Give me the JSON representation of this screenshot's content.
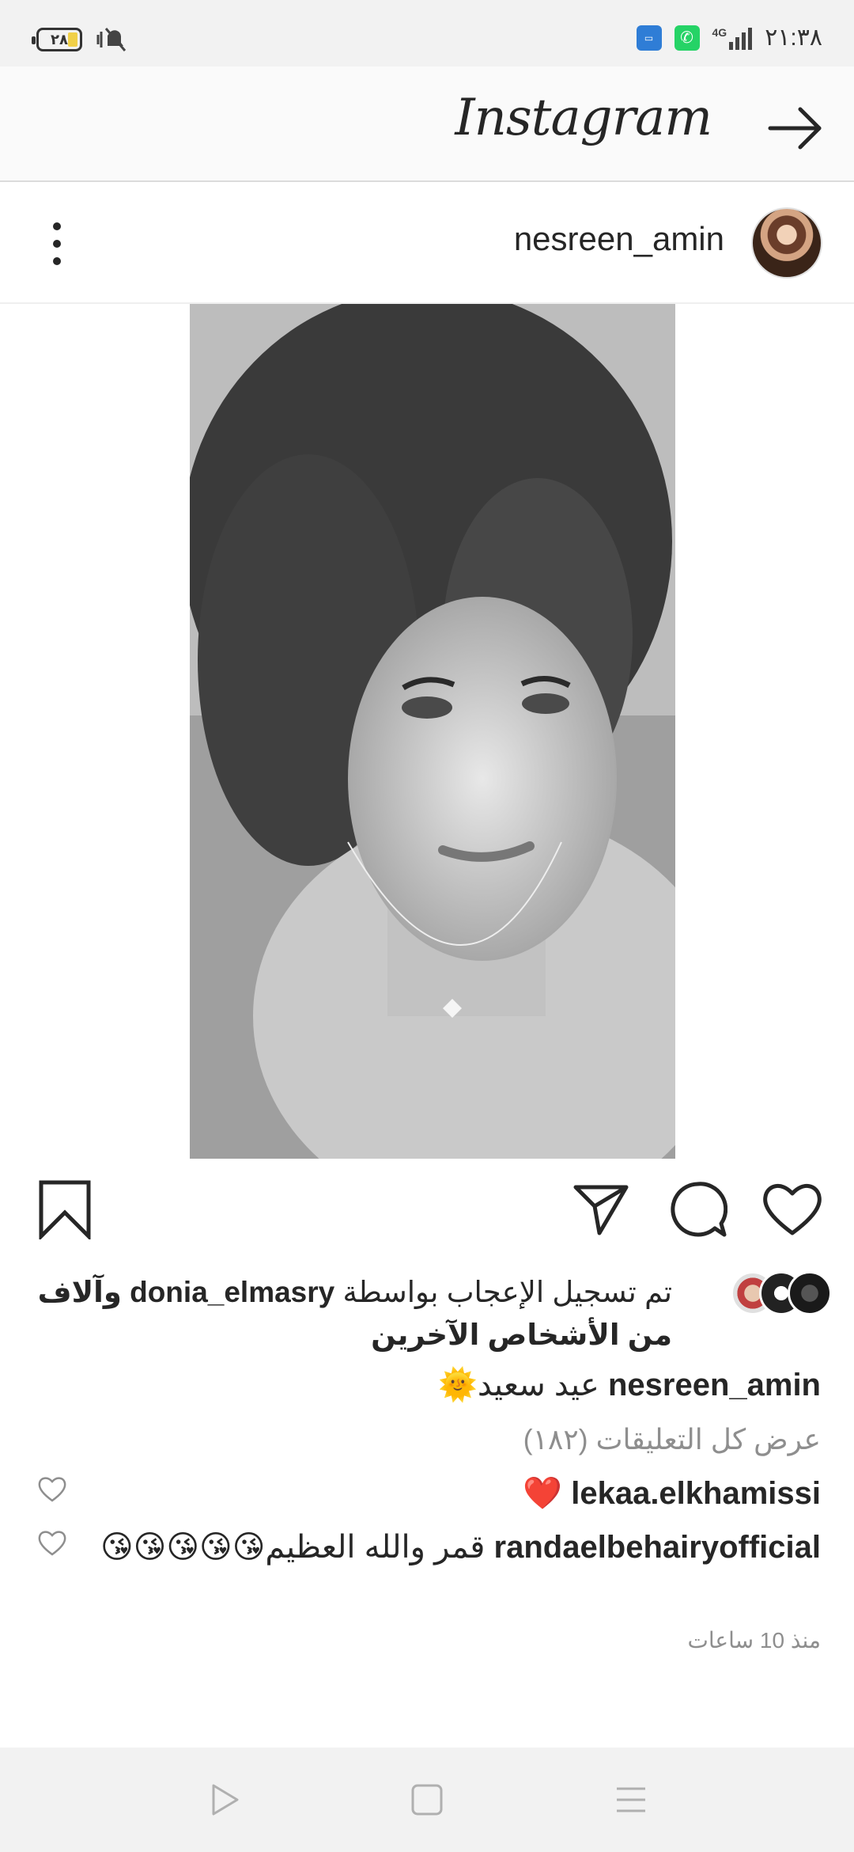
{
  "status_bar": {
    "time": "٢١:٣٨",
    "battery": "٢٨",
    "network": "4G",
    "apps": [
      "whatsapp",
      "app-blue"
    ],
    "icons": [
      "battery-icon",
      "silent-icon",
      "whatsapp-icon",
      "app-icon",
      "signal-icon"
    ]
  },
  "header": {
    "logo": "Instagram",
    "forward_icon": "arrow-right-icon"
  },
  "post": {
    "username": "nesreen_amin",
    "more_icon": "more-vertical-icon",
    "photo_alt": "black and white photo",
    "actions": [
      "heart-icon",
      "comment-icon",
      "share-icon",
      "bookmark-icon"
    ],
    "likes": {
      "prefix": "تم تسجيل الإعجاب بواسطة",
      "user": "donia_elmasry",
      "suffix": "وآلاف",
      "line2": "من الأشخاص الآخرين"
    },
    "caption": {
      "user": "nesreen_amin",
      "text": "عيد سعيد🌞"
    },
    "view_all": "عرض كل التعليقات (١٨٢)",
    "comments": [
      {
        "user": "lekaa.elkhamissi",
        "text": "❤️"
      },
      {
        "user": "randaelbehairyofficial",
        "text": "قمر والله العظيم😘😘😘😘😘"
      }
    ],
    "time_ago": "منذ 10 ساعات"
  },
  "nav_bar": {
    "buttons": [
      "back-triangle-icon",
      "home-square-icon",
      "menu-lines-icon"
    ]
  },
  "colors": {
    "text": "#262626",
    "muted": "#8e8e8e",
    "header_bg": "#fafafa",
    "nav_bg": "#f2f2f2",
    "heart_red": "#e02020"
  }
}
